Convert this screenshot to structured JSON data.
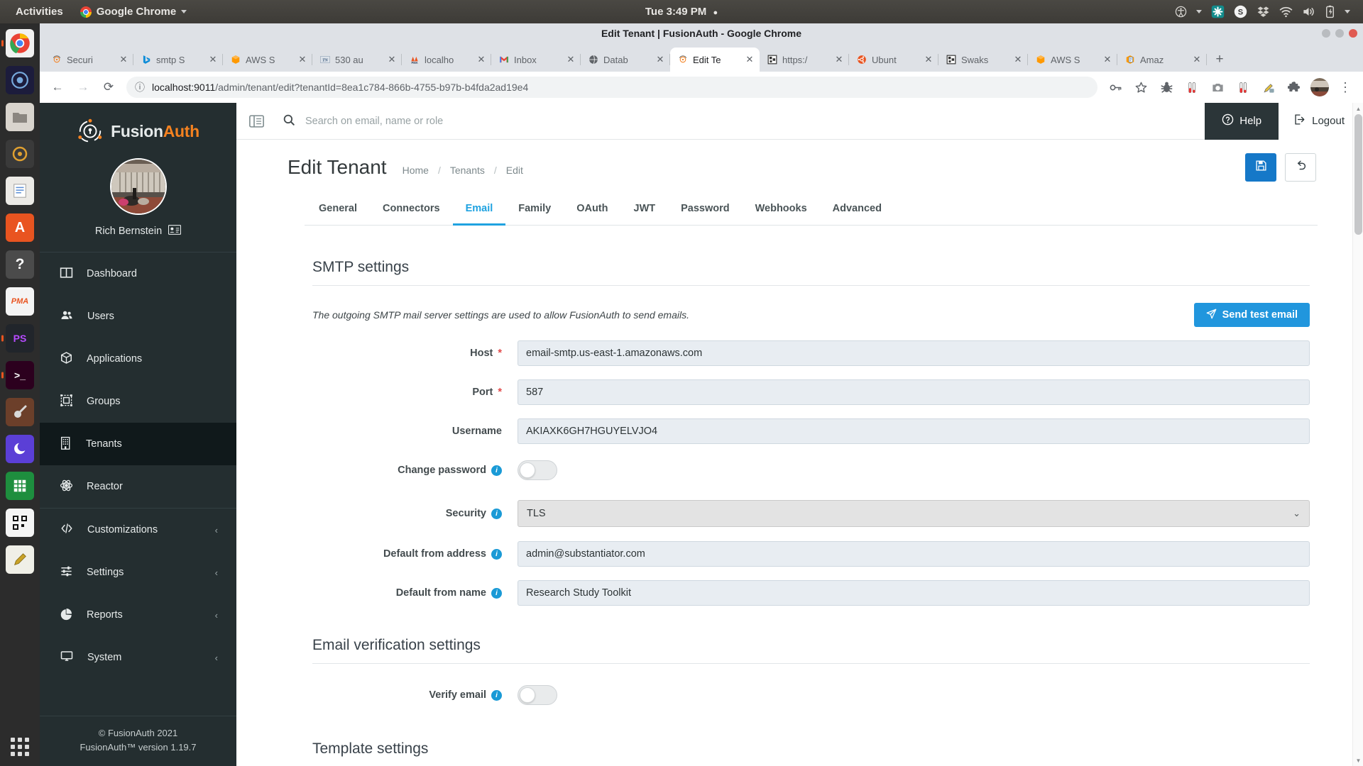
{
  "desktop": {
    "activities": "Activities",
    "app_menu": "Google Chrome",
    "clock": "Tue  3:49 PM",
    "clock_dot": "●",
    "tray": [
      {
        "name": "accessibility-icon",
        "glyph": "♿"
      },
      {
        "name": "tray-dropdown-icon",
        "glyph": "▾"
      },
      {
        "name": "puzzle-app-icon",
        "glyph": "✣"
      },
      {
        "name": "skype-icon",
        "glyph": "S"
      },
      {
        "name": "dropbox-icon",
        "glyph": "❖"
      },
      {
        "name": "wifi-icon",
        "glyph": "◠"
      },
      {
        "name": "volume-icon",
        "glyph": "▶"
      },
      {
        "name": "battery-icon",
        "glyph": "⚡"
      },
      {
        "name": "system-menu-dropdown-icon",
        "glyph": "▾"
      }
    ]
  },
  "dock": {
    "items": [
      {
        "name": "chrome",
        "label": "",
        "color": "#f1f1f1"
      },
      {
        "name": "firefox-dev",
        "label": "",
        "color": "#1e1e3f"
      },
      {
        "name": "files",
        "label": "",
        "color": "#d8d3cc"
      },
      {
        "name": "photos-app",
        "label": "",
        "color": "#3b3b3b"
      },
      {
        "name": "text-editor",
        "label": "",
        "color": "#e8e8e8"
      },
      {
        "name": "ubuntu-software",
        "label": "A",
        "color": "#e95420"
      },
      {
        "name": "help-center",
        "label": "?",
        "color": "#4a4a4a"
      },
      {
        "name": "phpmyadmin",
        "label": "PMA",
        "color": "#f5f5f5"
      },
      {
        "name": "phpstorm",
        "label": "PS",
        "color": "#21252b"
      },
      {
        "name": "terminal",
        "label": ">_",
        "color": "#2c001e"
      },
      {
        "name": "gparted",
        "label": "",
        "color": "#6c3f2a"
      },
      {
        "name": "insomnia",
        "label": "",
        "color": "#5b3fd6"
      },
      {
        "name": "spreadsheet",
        "label": "",
        "color": "#1e8e3e"
      },
      {
        "name": "qr-tool",
        "label": "",
        "color": "#f5f5f5"
      },
      {
        "name": "notes-app",
        "label": "",
        "color": "#f0efe7"
      }
    ]
  },
  "browser": {
    "window_title": "Edit Tenant | FusionAuth - Google Chrome",
    "window_buttons": [
      {
        "name": "minimize-button",
        "color": "#b9bcc0"
      },
      {
        "name": "maximize-button",
        "color": "#b9bcc0"
      },
      {
        "name": "close-button",
        "color": "#e05a52"
      }
    ],
    "tabs": [
      {
        "label": "Securi",
        "favicon": "fusionauth-icon",
        "active": false
      },
      {
        "label": "smtp S",
        "favicon": "bing-icon",
        "active": false
      },
      {
        "label": "AWS S",
        "favicon": "aws-cube-icon",
        "active": false
      },
      {
        "label": "530 au",
        "favicon": "tn-icon",
        "active": false
      },
      {
        "label": "localho",
        "favicon": "phpmyadmin-icon",
        "active": false
      },
      {
        "label": "Inbox",
        "favicon": "gmail-icon",
        "active": false
      },
      {
        "label": "Datab",
        "favicon": "globe-icon",
        "active": false
      },
      {
        "label": "Edit Te",
        "favicon": "fusionauth-icon",
        "active": true
      },
      {
        "label": "https:/",
        "favicon": "generic-page-icon",
        "active": false
      },
      {
        "label": "Ubunt",
        "favicon": "ubuntu-icon",
        "active": false
      },
      {
        "label": "Swaks",
        "favicon": "generic-page-icon",
        "active": false
      },
      {
        "label": "AWS S",
        "favicon": "aws-cube-icon",
        "active": false
      },
      {
        "label": "Amaz",
        "favicon": "amazon-doc-icon",
        "active": false
      }
    ],
    "tab_close_glyph": "✕",
    "new_tab_glyph": "+",
    "nav": {
      "back_glyph": "←",
      "forward_glyph": "→",
      "reload_glyph": "⟳",
      "info_glyph": "ⓘ"
    },
    "url_scheme_host": "localhost:9011",
    "url_path": "/admin/tenant/edit?tenantId=8ea1c784-866b-4755-b97b-b4fda2ad19e4",
    "toolbar_icons": [
      {
        "name": "password-key-icon",
        "glyph": "⚷"
      },
      {
        "name": "bookmark-star-icon",
        "glyph": "☆"
      },
      {
        "name": "bug-extension-icon",
        "glyph": "☸"
      },
      {
        "name": "test-tube-extension-icon",
        "glyph": "⚗"
      },
      {
        "name": "screenshot-camera-icon",
        "glyph": "▣"
      },
      {
        "name": "test-tube-extension-icon-2",
        "glyph": "⚗"
      },
      {
        "name": "color-picker-icon",
        "glyph": "✐"
      },
      {
        "name": "extensions-puzzle-icon",
        "glyph": "❖"
      },
      {
        "name": "profile-avatar-icon",
        "glyph": ""
      },
      {
        "name": "chrome-menu-icon",
        "glyph": "⋮"
      }
    ]
  },
  "sidebar": {
    "brand_fusion": "Fusion",
    "brand_auth": "Auth",
    "user_name": "Rich Bernstein",
    "user_badge_icon": "id-card-icon",
    "items": [
      {
        "label": "Dashboard",
        "icon": "dashboard-icon",
        "active": false,
        "expandable": false
      },
      {
        "label": "Users",
        "icon": "users-icon",
        "active": false,
        "expandable": false
      },
      {
        "label": "Applications",
        "icon": "applications-cube-icon",
        "active": false,
        "expandable": false
      },
      {
        "label": "Groups",
        "icon": "groups-icon",
        "active": false,
        "expandable": false
      },
      {
        "label": "Tenants",
        "icon": "tenants-building-icon",
        "active": true,
        "expandable": false
      },
      {
        "label": "Reactor",
        "icon": "reactor-icon",
        "active": false,
        "expandable": false
      },
      {
        "label": "Customizations",
        "icon": "code-icon",
        "active": false,
        "expandable": true
      },
      {
        "label": "Settings",
        "icon": "sliders-icon",
        "active": false,
        "expandable": true
      },
      {
        "label": "Reports",
        "icon": "pie-chart-icon",
        "active": false,
        "expandable": true
      },
      {
        "label": "System",
        "icon": "monitor-icon",
        "active": false,
        "expandable": true
      }
    ],
    "chevron_glyph": "‹",
    "footer_copyright": "© FusionAuth 2021",
    "footer_version": "FusionAuth™ version 1.19.7"
  },
  "topbar": {
    "collapse_icon": "collapse-sidebar-icon",
    "search_placeholder": "Search on email, name or role",
    "search_icon": "search-icon",
    "help_label": "Help",
    "help_icon": "help-circle-icon",
    "logout_label": "Logout",
    "logout_icon": "logout-icon"
  },
  "header": {
    "title": "Edit Tenant",
    "breadcrumbs": [
      "Home",
      "Tenants",
      "Edit"
    ],
    "separator": "/",
    "save_icon": "save-disk-icon",
    "back_icon": "undo-arrow-icon"
  },
  "tabs": [
    {
      "label": "General",
      "active": false
    },
    {
      "label": "Connectors",
      "active": false
    },
    {
      "label": "Email",
      "active": true
    },
    {
      "label": "Family",
      "active": false
    },
    {
      "label": "OAuth",
      "active": false
    },
    {
      "label": "JWT",
      "active": false
    },
    {
      "label": "Password",
      "active": false
    },
    {
      "label": "Webhooks",
      "active": false
    },
    {
      "label": "Advanced",
      "active": false
    }
  ],
  "smtp": {
    "section_title": "SMTP settings",
    "description": "The outgoing SMTP mail server settings are used to allow FusionAuth to send emails.",
    "send_test_label": "Send test email",
    "send_test_icon": "paper-plane-icon",
    "fields": {
      "host_label": "Host",
      "host_required": "*",
      "host_value": "email-smtp.us-east-1.amazonaws.com",
      "port_label": "Port",
      "port_required": "*",
      "port_value": "587",
      "username_label": "Username",
      "username_value": "AKIAXK6GH7HGUYELVJO4",
      "change_password_label": "Change password",
      "change_password_on": false,
      "security_label": "Security",
      "security_value": "TLS",
      "security_chevron": "⌄",
      "from_address_label": "Default from address",
      "from_address_value": "admin@substantiator.com",
      "from_name_label": "Default from name",
      "from_name_value": "Research Study Toolkit"
    }
  },
  "verification": {
    "section_title": "Email verification settings",
    "verify_email_label": "Verify email",
    "verify_email_on": false
  },
  "template": {
    "section_title": "Template settings"
  },
  "colors": {
    "accent_blue": "#1fa2e0",
    "button_blue": "#2196dd",
    "brand_orange": "#f58220",
    "sidebar_dark": "#242e30",
    "sidebar_active": "#10191b",
    "required_red": "#e24a4a"
  }
}
